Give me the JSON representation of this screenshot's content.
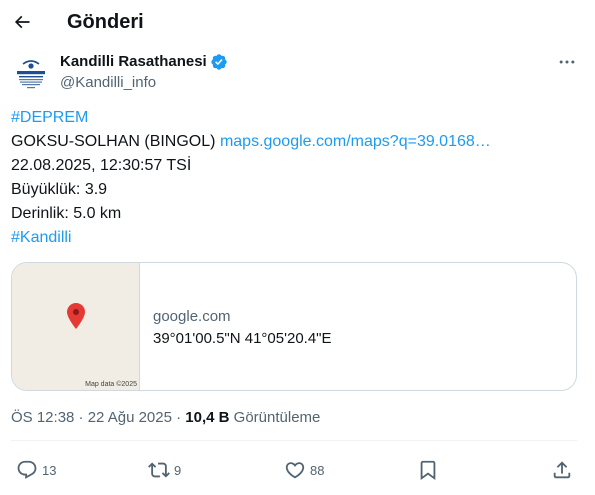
{
  "header": {
    "title": "Gönderi"
  },
  "author": {
    "name": "Kandilli Rasathanesi",
    "handle": "@Kandilli_info"
  },
  "tweet": {
    "hashtag_top": "#DEPREM",
    "location": "GOKSU-SOLHAN (BINGOL)",
    "location_link": "maps.google.com/maps?q=39.0168…",
    "datetime": "22.08.2025, 12:30:57 TSİ",
    "magnitude": "Büyüklük: 3.9",
    "depth": "Derinlik: 5.0 km",
    "hashtag_bottom": "#Kandilli"
  },
  "card": {
    "domain": "google.com",
    "coords": "39°01'00.5\"N 41°05'20.4\"E",
    "map_credit": "Map data ©2025"
  },
  "meta": {
    "time": "ÖS 12:38 · 22 Ağu 2025 · ",
    "views_count": "10,4 B",
    "views_label": " Görüntüleme"
  },
  "actions": {
    "replies": "13",
    "reposts": "9",
    "likes": "88"
  },
  "colors": {
    "link": "#1d9bf0",
    "verified": "#1d9bf0",
    "secondary": "#536471",
    "pin": "#e53935"
  }
}
